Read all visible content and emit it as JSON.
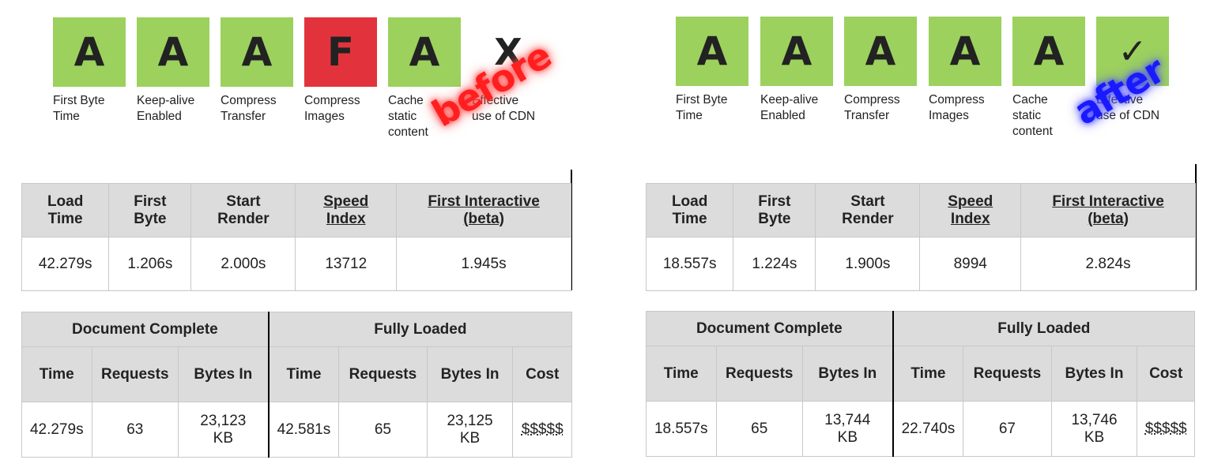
{
  "grade_labels": [
    "First Byte\nTime",
    "Keep-alive\nEnabled",
    "Compress\nTransfer",
    "Compress\nImages",
    "Cache\nstatic\ncontent",
    "Effective\nuse of CDN"
  ],
  "colors": {
    "pass": "#9cd15e",
    "fail": "#e2333d",
    "before_stamp": "#ff1f1f",
    "after_stamp": "#1a1aff"
  },
  "before": {
    "stamp": "before",
    "grades": [
      "A",
      "A",
      "A",
      "F",
      "A",
      "X"
    ],
    "summary_headers": [
      "Load Time",
      "First Byte",
      "Start Render",
      "Speed Index",
      "First Interactive (beta)"
    ],
    "summary_values": [
      "42.279s",
      "1.206s",
      "2.000s",
      "13712",
      "1.945s"
    ],
    "doc_title": "Document Complete",
    "full_title": "Fully Loaded",
    "detail_headers": [
      "Time",
      "Requests",
      "Bytes In",
      "Time",
      "Requests",
      "Bytes In",
      "Cost"
    ],
    "detail_values": [
      "42.279s",
      "63",
      "23,123 KB",
      "42.581s",
      "65",
      "23,125 KB",
      "$$$$$"
    ]
  },
  "after": {
    "stamp": "after",
    "grades": [
      "A",
      "A",
      "A",
      "A",
      "A",
      "✓"
    ],
    "summary_headers": [
      "Load Time",
      "First Byte",
      "Start Render",
      "Speed Index",
      "First Interactive (beta)"
    ],
    "summary_values": [
      "18.557s",
      "1.224s",
      "1.900s",
      "8994",
      "2.824s"
    ],
    "doc_title": "Document Complete",
    "full_title": "Fully Loaded",
    "detail_headers": [
      "Time",
      "Requests",
      "Bytes In",
      "Time",
      "Requests",
      "Bytes In",
      "Cost"
    ],
    "detail_values": [
      "18.557s",
      "65",
      "13,744 KB",
      "22.740s",
      "67",
      "13,746 KB",
      "$$$$$"
    ]
  }
}
